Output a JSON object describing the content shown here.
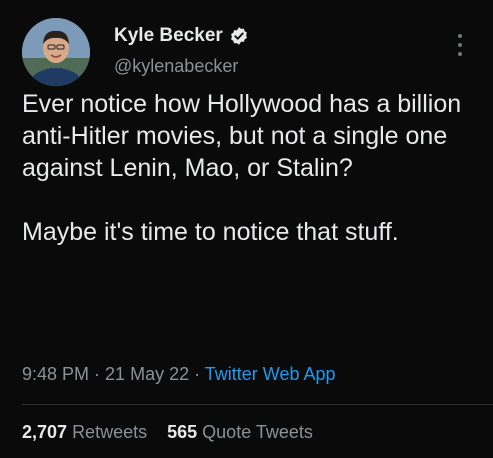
{
  "author": {
    "display_name": "Kyle Becker",
    "handle": "@kylenabecker",
    "verified": true,
    "avatar": "profile-photo"
  },
  "tweet": {
    "paragraphs": [
      "Ever notice how Hollywood has a billion anti-Hitler movies, but not a single one against Lenin, Mao, or Stalin?",
      "Maybe it's time to notice that stuff."
    ]
  },
  "meta": {
    "time": "9:48 PM",
    "separator": " · ",
    "date": "21 May 22",
    "source": "Twitter Web App"
  },
  "stats": {
    "retweets_count": "2,707",
    "retweets_label": "Retweets",
    "quotes_count": "565",
    "quotes_label": "Quote Tweets"
  },
  "colors": {
    "background": "#0a0a0a",
    "text": "#e7e9ea",
    "secondary": "#8b9197",
    "accent": "#1d9bf0"
  },
  "icons": {
    "verified": "verified-badge-icon",
    "more": "more-options-icon"
  }
}
